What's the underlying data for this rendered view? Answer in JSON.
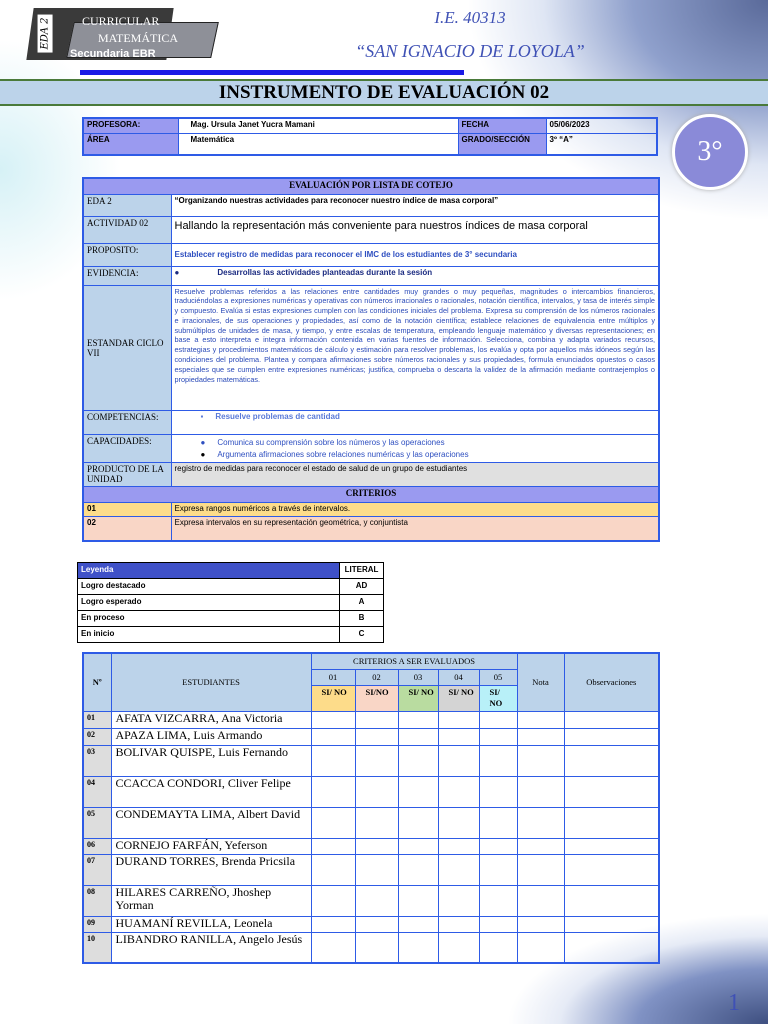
{
  "header": {
    "eda_tag": "EDA 2",
    "area_label": "CURRICULAR",
    "subject": "MATEMÁTICA",
    "level": "Secundaria EBR",
    "school_code": "I.E. 40313",
    "school_name": "“SAN IGNACIO DE LOYOLA”",
    "title": "INSTRUMENTO DE EVALUACIÓN 02",
    "grade_badge": "3°"
  },
  "info": {
    "profesora_label": "PROFESORA:",
    "profesora": "Mag. Ursula Janet Yucra Mamani",
    "fecha_label": "FECHA",
    "fecha": "05/06/2023",
    "area_label": "ÁREA",
    "area": "Matemática",
    "grado_label": "GRADO/SECCIÓN",
    "grado": "3º “A”"
  },
  "evaluation": {
    "title": "EVALUACIÓN POR LISTA DE COTEJO",
    "rows": [
      {
        "label": "EDA 2",
        "value": "“Organizando nuestras actividades para reconocer nuestro índice de masa corporal”"
      },
      {
        "label": "ACTIVIDAD 02",
        "value": "Hallando la representación más conveniente para nuestros índices de masa corporal"
      },
      {
        "label": "PROPOSITO:",
        "value": "Establecer registro de medidas para reconocer el IMC de los estudiantes de 3° secundaria"
      },
      {
        "label": "EVIDENCIA:",
        "value": "Desarrollas las actividades planteadas durante la sesión"
      },
      {
        "label": "ESTANDAR CICLO VII",
        "value": "Resuelve problemas referidos a las relaciones entre cantidades muy grandes o muy pequeñas, magnitudes o intercambios financieros, traduciéndolas a expresiones numéricas y operativas con números irracionales o racionales, notación científica, intervalos, y tasa de interés simple y compuesto. Evalúa si estas expresiones cumplen con las condiciones iniciales del problema. Expresa su comprensión de los números racionales e irracionales, de sus operaciones y propiedades, así como de la notación científica; establece relaciones de equivalencia entre múltiplos y submúltiplos de unidades de masa, y tiempo, y entre escalas de temperatura, empleando lenguaje matemático y diversas representaciones; en base a esto interpreta e integra información contenida en varias fuentes de información. Selecciona, combina y adapta variados recursos, estrategias y procedimientos matemáticos de cálculo y estimación para resolver problemas, los evalúa y opta por aquellos más idóneos según las condiciones del problema. Plantea y compara afirmaciones sobre números racionales y sus propiedades, formula enunciados opuestos o casos especiales que se cumplen entre expresiones numéricas; justifica, comprueba o descarta la validez de la afirmación mediante contraejemplos o propiedades matemáticas."
      },
      {
        "label": "COMPETENCIAS:",
        "value": "Resuelve problemas de cantidad"
      },
      {
        "label": "CAPACIDADES:",
        "values": [
          "Comunica su comprensión sobre los números y las operaciones",
          "Argumenta afirmaciones sobre relaciones numéricas y las operaciones"
        ]
      },
      {
        "label": "PRODUCTO DE LA UNIDAD",
        "value": "registro de medidas para reconocer el estado de salud de un grupo de estudiantes"
      }
    ],
    "criterios_title": "CRITERIOS",
    "criterios": [
      {
        "num": "01",
        "text": "Expresa rangos numéricos a través de intervalos."
      },
      {
        "num": "02",
        "text": "Expresa intervalos en su representación geométrica, y conjuntista"
      }
    ]
  },
  "legend": {
    "header": "Leyenda",
    "literal_header": "LITERAL",
    "rows": [
      {
        "label": "Logro destacado",
        "literal": "AD"
      },
      {
        "label": "Logro esperado",
        "literal": "A"
      },
      {
        "label": "En proceso",
        "literal": "B"
      },
      {
        "label": "En inicio",
        "literal": "C"
      }
    ]
  },
  "students_table": {
    "num_header": "Nº",
    "students_header": "ESTUDIANTES",
    "criteria_header": "CRITERIOS A SER EVALUADOS",
    "criteria": [
      "01",
      "02",
      "03",
      "04",
      "05"
    ],
    "sino": [
      "SI/ NO",
      "SI/NO",
      "SI/ NO",
      "SI/ NO",
      "SI/ NO"
    ],
    "nota_header": "Nota",
    "obs_header": "Observaciones",
    "students": [
      {
        "num": "01",
        "name": "AFATA VIZCARRA, Ana Victoria"
      },
      {
        "num": "02",
        "name": "APAZA LIMA, Luis Armando"
      },
      {
        "num": "03",
        "name": "BOLIVAR QUISPE, Luis Fernando"
      },
      {
        "num": "04",
        "name": "CCACCA CONDORI, Cliver Felipe"
      },
      {
        "num": "05",
        "name": "CONDEMAYTA LIMA, Albert David"
      },
      {
        "num": "06",
        "name": "CORNEJO FARFÁN, Yeferson"
      },
      {
        "num": "07",
        "name": "DURAND TORRES, Brenda Pricsila"
      },
      {
        "num": "08",
        "name": "HILARES CARREÑO, Jhoshep Yorman"
      },
      {
        "num": "09",
        "name": "HUAMANÍ REVILLA, Leonela"
      },
      {
        "num": "10",
        "name": "LIBANDRO RANILLA,  Angelo Jesús"
      }
    ]
  },
  "page_number": "1"
}
